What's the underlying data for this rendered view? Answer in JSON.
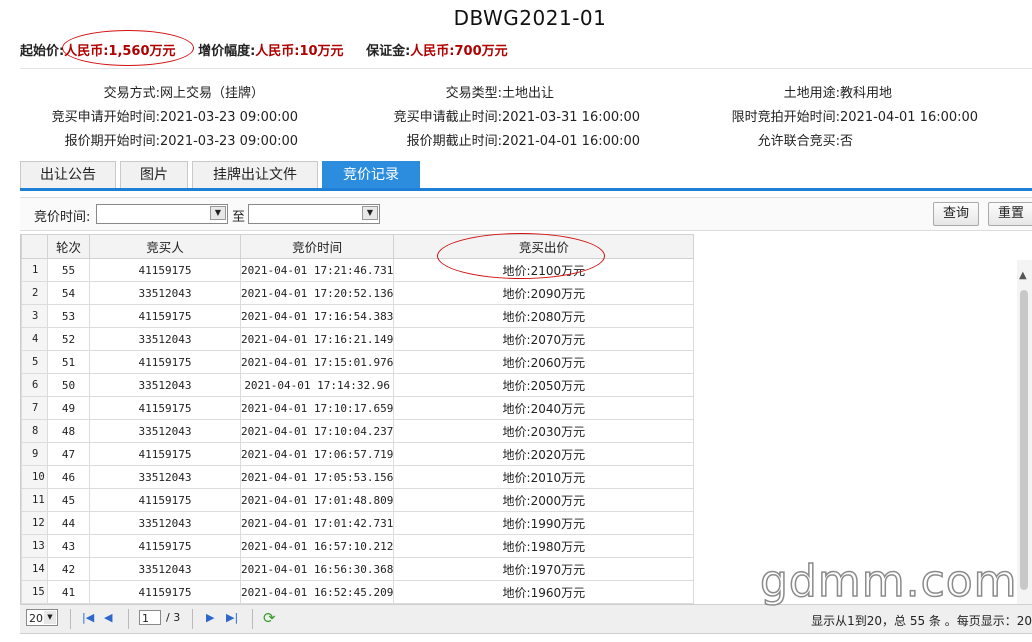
{
  "title": "DBWG2021-01",
  "pricing": {
    "start_label": "起始价:",
    "start_value": "人民币:1,560万元",
    "increment_label": "增价幅度:",
    "increment_value": "人民币:10万元",
    "deposit_label": "保证金:",
    "deposit_value": "人民币:700万元"
  },
  "info": {
    "trade_mode_label": "交易方式:",
    "trade_mode_value": "网上交易（挂牌）",
    "trade_type_label": "交易类型:",
    "trade_type_value": "土地出让",
    "land_use_label": "土地用途:",
    "land_use_value": "教科用地",
    "apply_start_label": "竞买申请开始时间:",
    "apply_start_value": "2021-03-23 09:00:00",
    "apply_end_label": "竞买申请截止时间:",
    "apply_end_value": "2021-03-31 16:00:00",
    "bid_start_label": "限时竞拍开始时间:",
    "bid_start_value": "2021-04-01 16:00:00",
    "quote_start_label": "报价期开始时间:",
    "quote_start_value": "2021-03-23 09:00:00",
    "quote_end_label": "报价期截止时间:",
    "quote_end_value": "2021-04-01 16:00:00",
    "joint_label": "允许联合竞买:",
    "joint_value": "否"
  },
  "tabs": [
    "出让公告",
    "图片",
    "挂牌出让文件",
    "竞价记录"
  ],
  "filter": {
    "time_label": "竞价时间:",
    "to_label": "至",
    "query_button": "查询",
    "reset_button": "重置"
  },
  "table": {
    "headers": [
      "轮次",
      "竞买人",
      "竞价时间",
      "竞买出价"
    ],
    "rows": [
      [
        "1",
        "55",
        "41159175",
        "2021-04-01 17:21:46.731",
        "地价:2100万元"
      ],
      [
        "2",
        "54",
        "33512043",
        "2021-04-01 17:20:52.136",
        "地价:2090万元"
      ],
      [
        "3",
        "53",
        "41159175",
        "2021-04-01 17:16:54.383",
        "地价:2080万元"
      ],
      [
        "4",
        "52",
        "33512043",
        "2021-04-01 17:16:21.149",
        "地价:2070万元"
      ],
      [
        "5",
        "51",
        "41159175",
        "2021-04-01 17:15:01.976",
        "地价:2060万元"
      ],
      [
        "6",
        "50",
        "33512043",
        "2021-04-01 17:14:32.96",
        "地价:2050万元"
      ],
      [
        "7",
        "49",
        "41159175",
        "2021-04-01 17:10:17.659",
        "地价:2040万元"
      ],
      [
        "8",
        "48",
        "33512043",
        "2021-04-01 17:10:04.237",
        "地价:2030万元"
      ],
      [
        "9",
        "47",
        "41159175",
        "2021-04-01 17:06:57.719",
        "地价:2020万元"
      ],
      [
        "10",
        "46",
        "33512043",
        "2021-04-01 17:05:53.156",
        "地价:2010万元"
      ],
      [
        "11",
        "45",
        "41159175",
        "2021-04-01 17:01:48.809",
        "地价:2000万元"
      ],
      [
        "12",
        "44",
        "33512043",
        "2021-04-01 17:01:42.731",
        "地价:1990万元"
      ],
      [
        "13",
        "43",
        "41159175",
        "2021-04-01 16:57:10.212",
        "地价:1980万元"
      ],
      [
        "14",
        "42",
        "33512043",
        "2021-04-01 16:56:30.368",
        "地价:1970万元"
      ],
      [
        "15",
        "41",
        "41159175",
        "2021-04-01 16:52:45.209",
        "地价:1960万元"
      ]
    ]
  },
  "pager": {
    "page_size": "20",
    "current_page": "1",
    "total_pages": "/ 3",
    "summary": "显示从1到20，总 55 条 。每页显示：20"
  },
  "watermark": "gdmm.com",
  "colors": {
    "accent": "#2c8ddf",
    "price_red": "#b00000",
    "annotation_red": "#d01010"
  },
  "icons": [
    "dropdown-arrow-icon",
    "first-page-icon",
    "prev-page-icon",
    "next-page-icon",
    "last-page-icon",
    "refresh-icon",
    "scroll-up-icon"
  ]
}
